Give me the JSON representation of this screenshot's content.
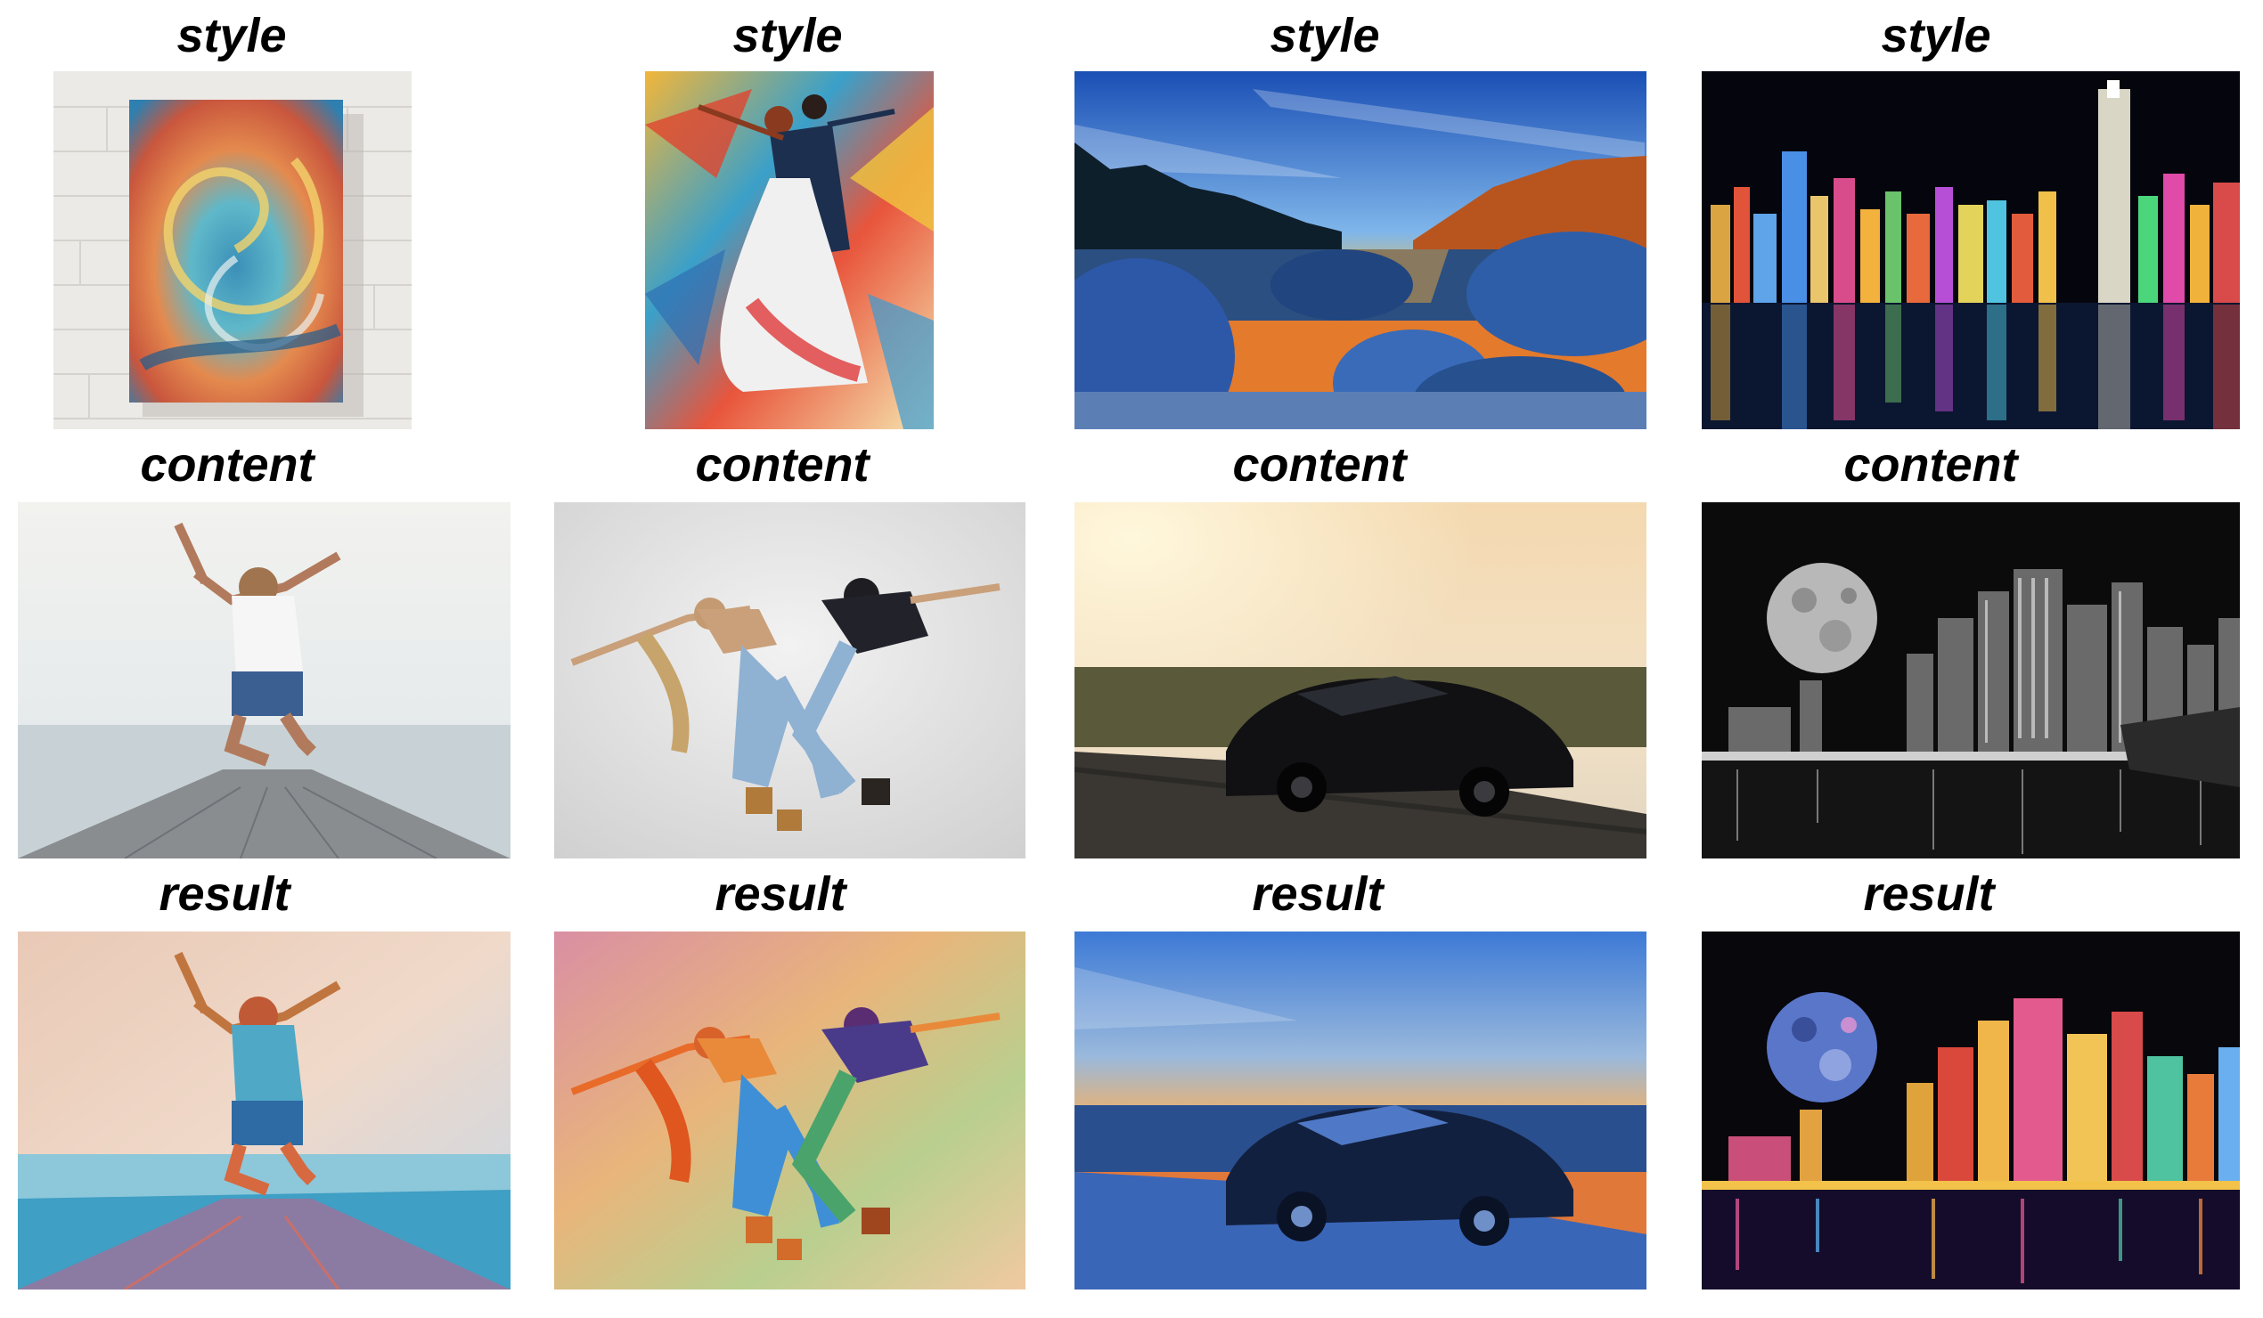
{
  "figure": {
    "style_label": "style",
    "content_label": "content",
    "result_label": "result"
  },
  "panels": [
    {
      "row": "style",
      "column": 1,
      "subject": "swirl painting canvas on white brick wall"
    },
    {
      "row": "style",
      "column": 2,
      "subject": "colorful palette-knife painting of ballroom dancers"
    },
    {
      "row": "style",
      "column": 3,
      "subject": "blue HDR lake landscape with rocks at sunset"
    },
    {
      "row": "style",
      "column": 4,
      "subject": "neon city skyline at night reflected in water"
    },
    {
      "row": "content",
      "column": 1,
      "subject": "woman jumping on pier by the sea"
    },
    {
      "row": "content",
      "column": 2,
      "subject": "two dancers in mid-move on grey backdrop"
    },
    {
      "row": "content",
      "column": 3,
      "subject": "black sports car on road at dusk"
    },
    {
      "row": "content",
      "column": 4,
      "subject": "black and white city skyline with large moon"
    },
    {
      "row": "result",
      "column": 1,
      "subject": "stylized jumping woman on pier"
    },
    {
      "row": "result",
      "column": 2,
      "subject": "stylized dancers"
    },
    {
      "row": "result",
      "column": 3,
      "subject": "stylized sports car in blue landscape"
    },
    {
      "row": "result",
      "column": 4,
      "subject": "stylized neon city with moon"
    }
  ],
  "colors": {
    "background": "#ffffff",
    "label": "#000000"
  }
}
